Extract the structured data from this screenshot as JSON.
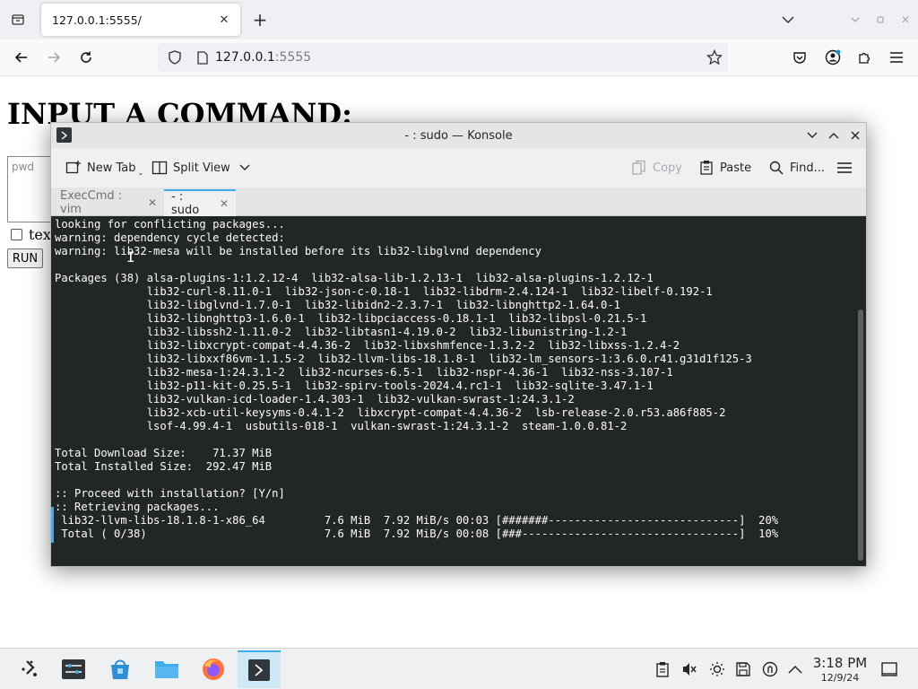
{
  "browser": {
    "tab_title": "127.0.0.1:5555/",
    "url_host": "127.0.0.1",
    "url_port": ":5555"
  },
  "page": {
    "heading": "INPUT A COMMAND:",
    "textarea_placeholder": "pwd",
    "checkbox_label": "tex",
    "run_label": "RUN"
  },
  "konsole": {
    "title": "- : sudo — Konsole",
    "toolbar": {
      "new_tab": "New Tab",
      "split_view": "Split View",
      "copy": "Copy",
      "paste": "Paste",
      "find": "Find..."
    },
    "tabs": [
      {
        "label": "ExecCmd : vim",
        "active": false
      },
      {
        "label": "- : sudo",
        "active": true
      }
    ],
    "terminal_lines": [
      "looking for conflicting packages...",
      "warning: dependency cycle detected:",
      "warning: lib32-mesa will be installed before its lib32-libglvnd dependency",
      "",
      "Packages (38) alsa-plugins-1:1.2.12-4  lib32-alsa-lib-1.2.13-1  lib32-alsa-plugins-1.2.12-1",
      "              lib32-curl-8.11.0-1  lib32-json-c-0.18-1  lib32-libdrm-2.4.124-1  lib32-libelf-0.192-1",
      "              lib32-libglvnd-1.7.0-1  lib32-libidn2-2.3.7-1  lib32-libnghttp2-1.64.0-1",
      "              lib32-libnghttp3-1.6.0-1  lib32-libpciaccess-0.18.1-1  lib32-libpsl-0.21.5-1",
      "              lib32-libssh2-1.11.0-2  lib32-libtasn1-4.19.0-2  lib32-libunistring-1.2-1",
      "              lib32-libxcrypt-compat-4.4.36-2  lib32-libxshmfence-1.3.2-2  lib32-libxss-1.2.4-2",
      "              lib32-libxxf86vm-1.1.5-2  lib32-llvm-libs-18.1.8-1  lib32-lm_sensors-1:3.6.0.r41.g31d1f125-3",
      "              lib32-mesa-1:24.3.1-2  lib32-ncurses-6.5-1  lib32-nspr-4.36-1  lib32-nss-3.107-1",
      "              lib32-p11-kit-0.25.5-1  lib32-spirv-tools-2024.4.rc1-1  lib32-sqlite-3.47.1-1",
      "              lib32-vulkan-icd-loader-1.4.303-1  lib32-vulkan-swrast-1:24.3.1-2",
      "              lib32-xcb-util-keysyms-0.4.1-2  libxcrypt-compat-4.4.36-2  lsb-release-2.0.r53.a86f885-2",
      "              lsof-4.99.4-1  usbutils-018-1  vulkan-swrast-1:24.3.1-2  steam-1.0.0.81-2",
      "",
      "Total Download Size:    71.37 MiB",
      "Total Installed Size:  292.47 MiB",
      "",
      ":: Proceed with installation? [Y/n]",
      ":: Retrieving packages...",
      " lib32-llvm-libs-18.1.8-1-x86_64         7.6 MiB  7.92 MiB/s 00:03 [#######-----------------------------]  20%",
      " Total ( 0/38)                           7.6 MiB  7.92 MiB/s 00:08 [###---------------------------------]  10%"
    ]
  },
  "taskbar": {
    "time": "3:18 PM",
    "date": "12/9/24"
  }
}
